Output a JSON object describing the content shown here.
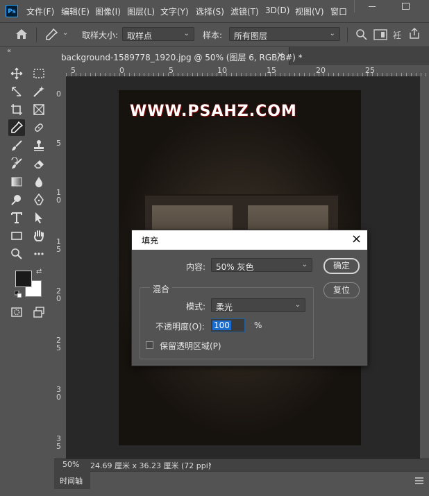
{
  "app": {
    "logo": "Ps"
  },
  "menu": [
    "文件(F)",
    "编辑(E)",
    "图像(I)",
    "图层(L)",
    "文字(Y)",
    "选择(S)",
    "滤镜(T)",
    "3D(D)",
    "视图(V)",
    "窗口"
  ],
  "options_bar": {
    "sample_size_label": "取样大小:",
    "sample_size_value": "取样点",
    "sample_label": "样本:",
    "sample_value": "所有图层",
    "partial_text": "衽"
  },
  "collapse_glyph": "«",
  "document_tab": {
    "title": "background-1589778_1920.jpg @ 50% (图层 6, RGB/8#) *",
    "close": "×"
  },
  "ruler": {
    "top_labels": [
      "5",
      "0",
      "5",
      "10",
      "15",
      "20",
      "25"
    ],
    "left_labels": [
      "0",
      "5",
      "1\n0",
      "1\n5",
      "2\n0",
      "2\n5",
      "3\n0",
      "3\n5"
    ]
  },
  "document": {
    "watermark": "WWW.PSAHZ.COM"
  },
  "status": {
    "zoom": "50%",
    "dimensions": "24.69 厘米 x 36.23 厘米 (72 ppi)",
    "arrow": "›"
  },
  "timeline": {
    "tab_label": "时间轴"
  },
  "fill_dialog": {
    "title": "填充",
    "close": "×",
    "contents_label": "内容:",
    "contents_value": "50% 灰色",
    "ok_label": "确定",
    "reset_label": "复位",
    "blending_label": "混合",
    "mode_label": "模式:",
    "mode_value": "柔光",
    "opacity_label": "不透明度(O):",
    "opacity_value": "100",
    "opacity_unit": "%",
    "preserve_label": "保留透明区域(P)",
    "preserve_checked": false
  },
  "colors": {
    "foreground": "#1a1a1a",
    "background": "#ffffff",
    "accent": "#31a8ff"
  }
}
